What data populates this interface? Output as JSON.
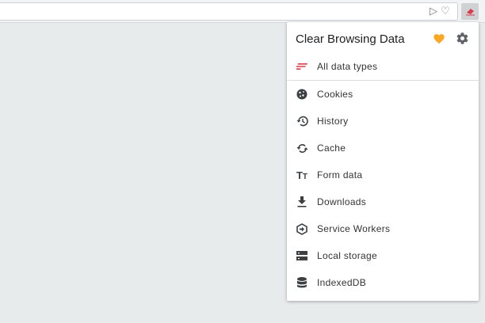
{
  "popup": {
    "title": "Clear Browsing Data",
    "all": "All data types",
    "items": [
      {
        "label": "Cookies",
        "icon": "cookie-icon"
      },
      {
        "label": "History",
        "icon": "history-icon"
      },
      {
        "label": "Cache",
        "icon": "sync-icon"
      },
      {
        "label": "Form data",
        "icon": "text-size-icon"
      },
      {
        "label": "Downloads",
        "icon": "download-icon"
      },
      {
        "label": "Service Workers",
        "icon": "hexagon-arrow-icon"
      },
      {
        "label": "Local storage",
        "icon": "storage-icon"
      },
      {
        "label": "IndexedDB",
        "icon": "database-icon"
      }
    ]
  },
  "colors": {
    "accent": "#f9a825",
    "eraser": "#d93a4a",
    "icon": "#3c4043"
  }
}
